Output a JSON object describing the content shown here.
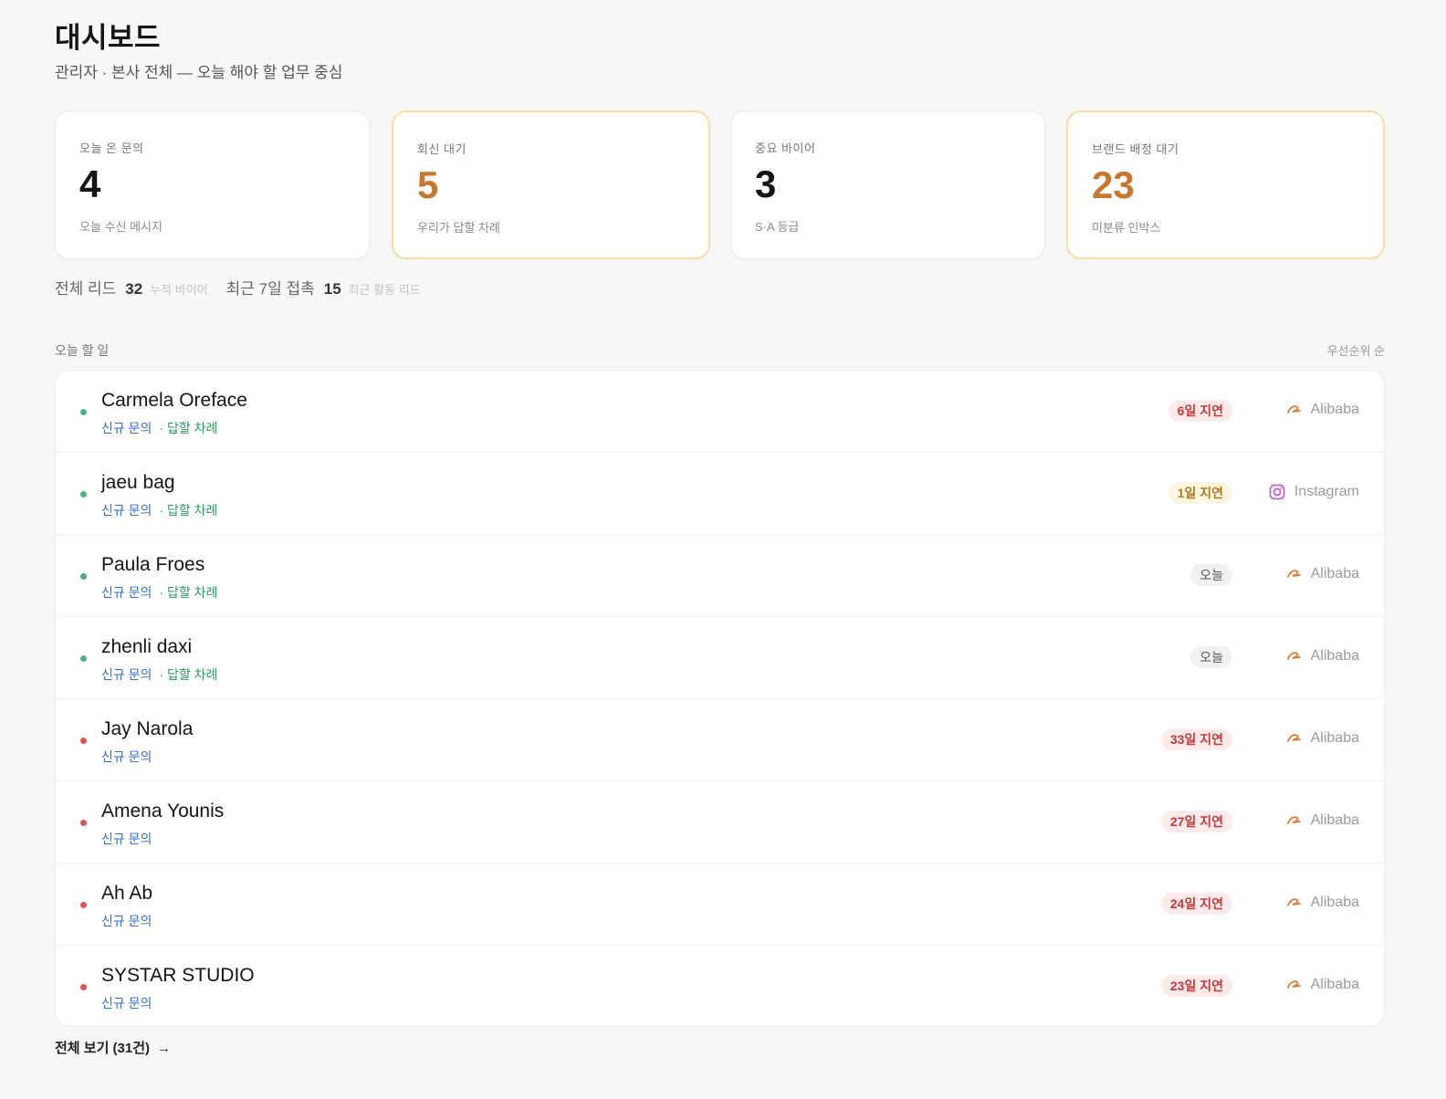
{
  "header": {
    "title": "대시보드",
    "subtitle": "관리자 · 본사 전체 — 오늘 해야 할 업무 중심"
  },
  "cards": [
    {
      "label": "오늘 온 문의",
      "value": "4",
      "sub": "오늘 수신 메시지"
    },
    {
      "label": "회신 대기",
      "value": "5",
      "sub": "우리가 답할 차례"
    },
    {
      "label": "중요 바이어",
      "value": "3",
      "sub": "S·A 등급"
    },
    {
      "label": "브랜드 배정 대기",
      "value": "23",
      "sub": "미분류 인박스"
    }
  ],
  "stats": {
    "total_label": "전체 리드",
    "total_value": "32",
    "total_hint": "누적 바이어",
    "recent_label": "최근 7일 접촉",
    "recent_value": "15",
    "recent_hint": "최근 활동 리드"
  },
  "section": {
    "label": "오늘 할 일",
    "sort": "우선순위 순"
  },
  "rows": [
    {
      "name": "Carmela Oreface",
      "tag_new": "신규 문의",
      "tag_reply": "· 답할 차례",
      "status": "green",
      "badge": "6일 지연",
      "badge_type": "red",
      "source": "Alibaba",
      "source_icon": "alibaba-icon"
    },
    {
      "name": "jaeu bag",
      "tag_new": "신규 문의",
      "tag_reply": "· 답할 차례",
      "status": "green",
      "badge": "1일 지연",
      "badge_type": "yellow",
      "source": "Instagram",
      "source_icon": "instagram-icon"
    },
    {
      "name": "Paula Froes",
      "tag_new": "신규 문의",
      "tag_reply": "· 답할 차례",
      "status": "green",
      "badge": "오늘",
      "badge_type": "gray",
      "source": "Alibaba",
      "source_icon": "alibaba-icon"
    },
    {
      "name": "zhenli daxi",
      "tag_new": "신규 문의",
      "tag_reply": "· 답할 차례",
      "status": "green",
      "badge": "오늘",
      "badge_type": "gray",
      "source": "Alibaba",
      "source_icon": "alibaba-icon"
    },
    {
      "name": "Jay Narola",
      "tag_new": "신규 문의",
      "tag_reply": "",
      "status": "red",
      "badge": "33일 지연",
      "badge_type": "red",
      "source": "Alibaba",
      "source_icon": "alibaba-icon"
    },
    {
      "name": "Amena Younis",
      "tag_new": "신규 문의",
      "tag_reply": "",
      "status": "red",
      "badge": "27일 지연",
      "badge_type": "red",
      "source": "Alibaba",
      "source_icon": "alibaba-icon"
    },
    {
      "name": "Ah Ab",
      "tag_new": "신규 문의",
      "tag_reply": "",
      "status": "red",
      "badge": "24일 지연",
      "badge_type": "red",
      "source": "Alibaba",
      "source_icon": "alibaba-icon"
    },
    {
      "name": "SYSTAR STUDIO",
      "tag_new": "신규 문의",
      "tag_reply": "",
      "status": "red",
      "badge": "23일 지연",
      "badge_type": "red",
      "source": "Alibaba",
      "source_icon": "alibaba-icon"
    }
  ],
  "footer": {
    "view_all": "전체 보기 (31건)",
    "arrow": "→"
  },
  "colors": {
    "accent_orange": "#c8772e",
    "highlight_border": "#f4dfa6",
    "status_green": "#4bb37d",
    "status_red": "#e05353",
    "tag_blue": "#2f6fd6"
  }
}
